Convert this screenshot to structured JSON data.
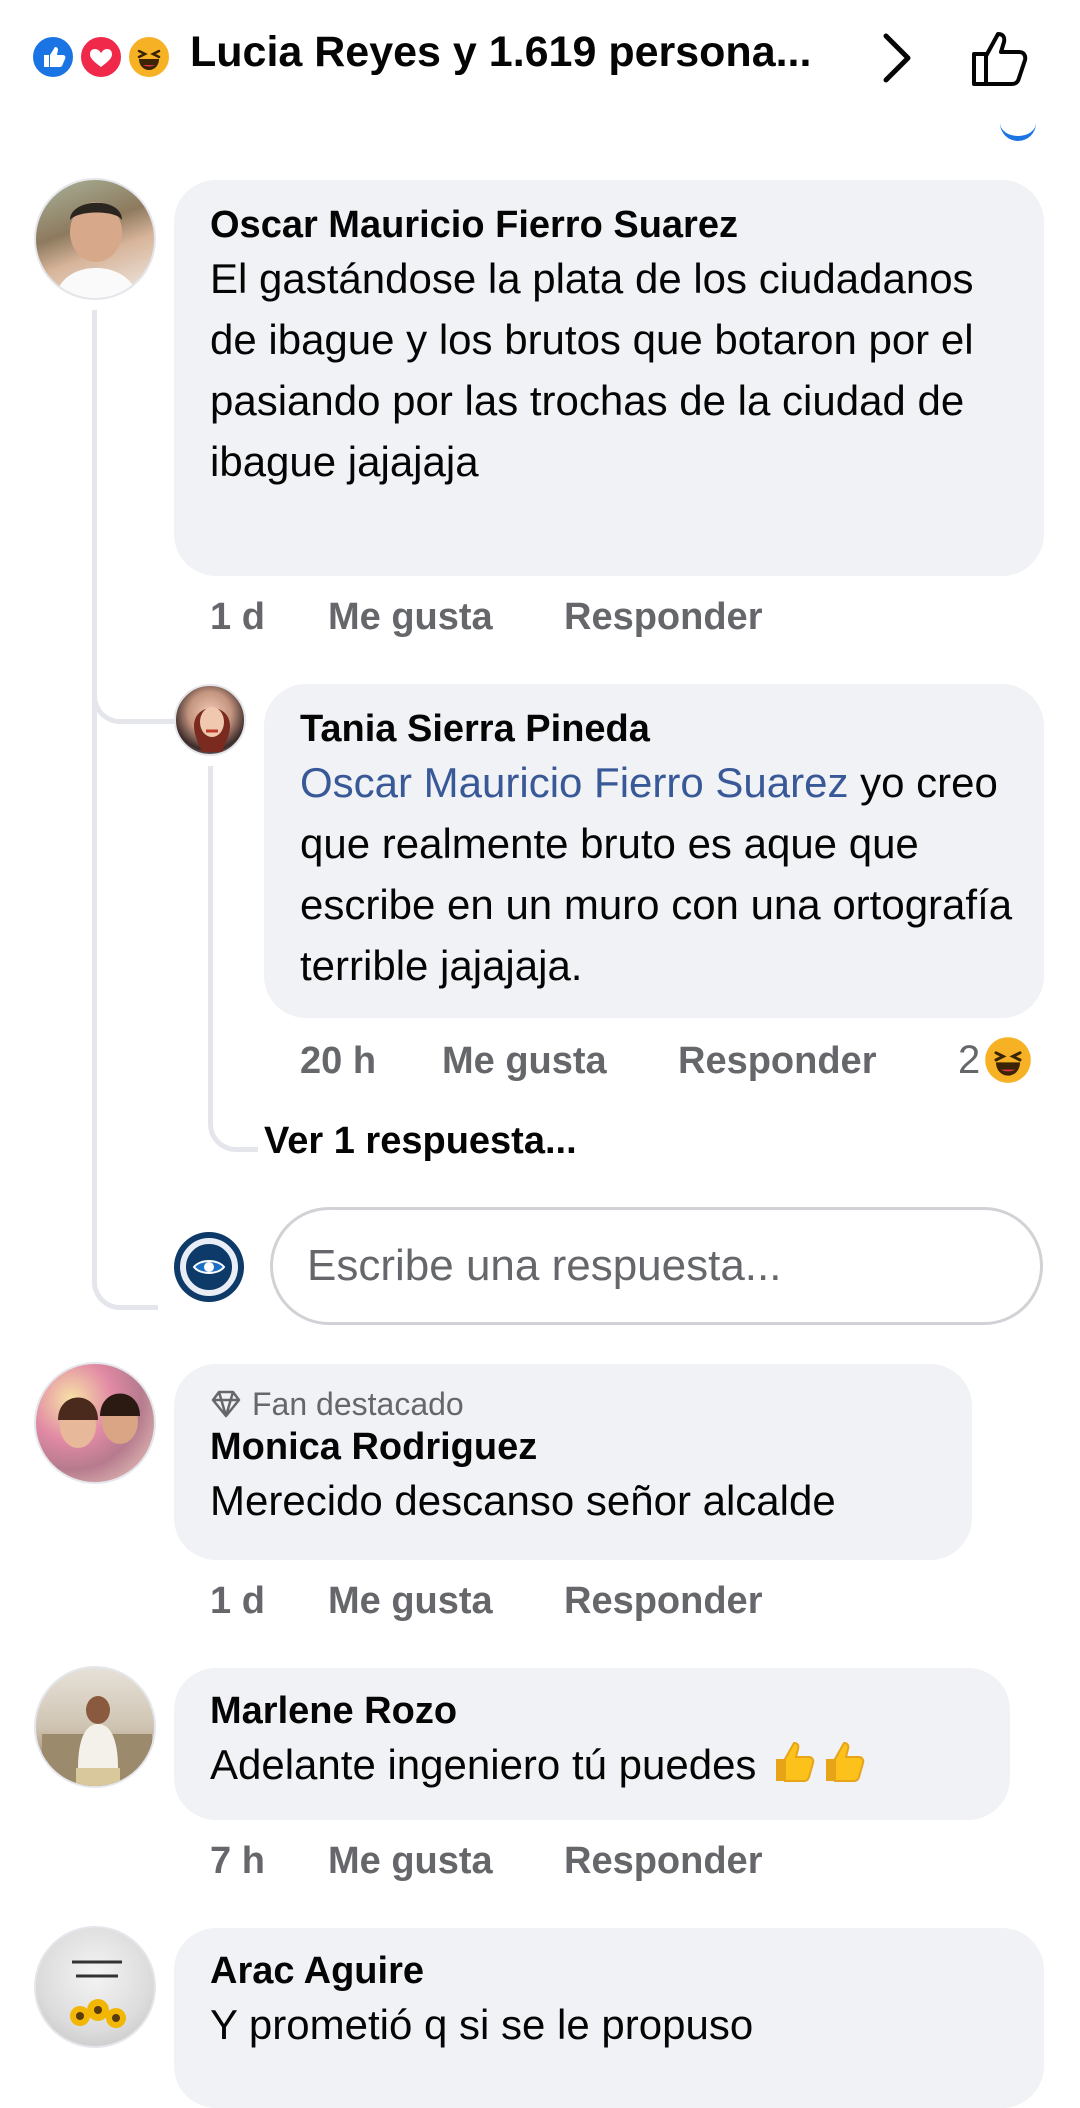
{
  "header": {
    "title": "Lucia Reyes y 1.619 persona...",
    "reactions": [
      "like-icon",
      "love-icon",
      "haha-icon"
    ]
  },
  "colors": {
    "accent": "#1b74e4",
    "mention": "#385898",
    "bubble": "#f0f2f5",
    "meta": "#65676b"
  },
  "comments": [
    {
      "author": "Oscar Mauricio Fierro Suarez",
      "text": "El gastándose la plata de los ciudadanos de ibague y los brutos que botaron por el pasiando por las trochas de la ciudad de ibague jajajaja",
      "time": "1 d",
      "like": "Me gusta",
      "reply": "Responder",
      "replies": [
        {
          "author": "Tania Sierra Pineda",
          "mention": "Oscar Mauricio Fierro Suarez",
          "text": " yo creo que realmente bruto es aque que escribe en un muro con una ortografía terrible jajajaja.",
          "time": "20 h",
          "like": "Me gusta",
          "reply": "Responder",
          "reaction_count": "2"
        }
      ],
      "view_more": "Ver 1 respuesta...",
      "reply_placeholder": "Escribe una respuesta..."
    },
    {
      "badge": "Fan destacado",
      "author": "Monica Rodriguez",
      "text": "Merecido descanso señor alcalde",
      "time": "1 d",
      "like": "Me gusta",
      "reply": "Responder"
    },
    {
      "author": "Marlene Rozo",
      "text": "Adelante ingeniero tú puedes",
      "time": "7 h",
      "like": "Me gusta",
      "reply": "Responder"
    },
    {
      "author": "Arac Aguire",
      "text": "Y prometió q si  se le propuso"
    }
  ]
}
